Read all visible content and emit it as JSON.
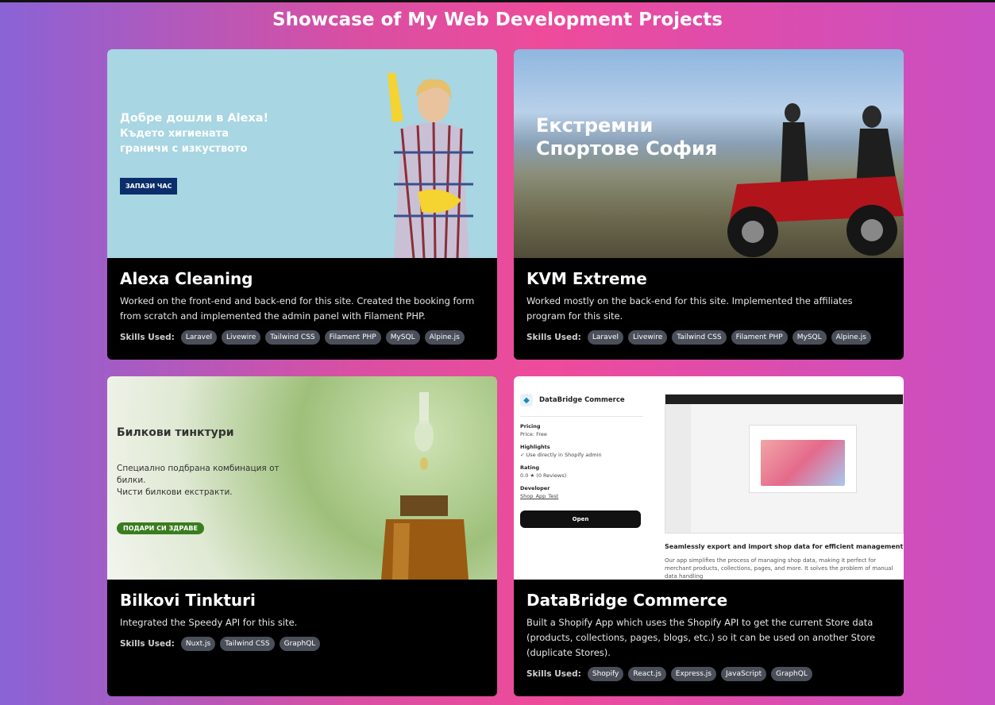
{
  "page": {
    "title": "Showcase of My Web Development Projects"
  },
  "skills_label": "Skills Used:",
  "projects": [
    {
      "title": "Alexa Cleaning",
      "description": "Worked on the front-end and back-end for this site. Created the booking form from scratch and implemented the admin panel with Filament PHP.",
      "skills": [
        "Laravel",
        "Livewire",
        "Tailwind CSS",
        "Filament PHP",
        "MySQL",
        "Alpine.js"
      ],
      "thumb": {
        "headline_1": "Добре дошли в Alexa!",
        "headline_2": "Където хигиената",
        "headline_3": "граничи с изкуството",
        "cta": "ЗАПАЗИ ЧАС"
      }
    },
    {
      "title": "KVM Extreme",
      "description": "Worked mostly on the back-end for this site. Implemented the affiliates program for this site.",
      "skills": [
        "Laravel",
        "Livewire",
        "Tailwind CSS",
        "Filament PHP",
        "MySQL",
        "Alpine.js"
      ],
      "thumb": {
        "headline_1": "Екстремни",
        "headline_2": "Спортове София"
      }
    },
    {
      "title": "Bilkovi Tinkturi",
      "description": "Integrated the Speedy API for this site.",
      "skills": [
        "Nuxt.js",
        "Tailwind CSS",
        "GraphQL"
      ],
      "thumb": {
        "headline": "Билкови тинктури",
        "sub_1": "Специално подбрана комбинация от",
        "sub_2": "билки.",
        "sub_3": "Чисти билкови екстракти.",
        "cta": "ПОДАРИ СИ ЗДРАВЕ"
      }
    },
    {
      "title": "DataBridge Commerce",
      "description": "Built a Shopify App which uses the Shopify API to get the current Store data (products, collections, pages, blogs, etc.) so it can be used on another Store (duplicate Stores).",
      "skills": [
        "Shopify",
        "React.js",
        "Express.js",
        "JavaScript",
        "GraphQL"
      ],
      "thumb": {
        "app_name": "DataBridge Commerce",
        "pricing_h": "Pricing",
        "pricing_v": "Price: Free",
        "highlights_h": "Highlights",
        "highlights_v": "✓ Use directly in Shopify admin",
        "rating_h": "Rating",
        "rating_v": "0.0 ★ (0 Reviews)",
        "developer_h": "Developer",
        "developer_v": "Shop_App_Test",
        "open": "Open",
        "tagline": "Seamlessly export and import shop data for efficient management and gro",
        "para": "Our app simplifies the process of managing shop data, making it perfect for merchant products, collections, pages, and more. It solves the problem of manual data handling"
      }
    }
  ],
  "colors": {
    "card_bg": "#000000",
    "tag_bg": "#4a4f59",
    "gradient_left": "#8a63d6",
    "gradient_mid": "#ee4b9a",
    "gradient_right": "#c94fc3"
  }
}
